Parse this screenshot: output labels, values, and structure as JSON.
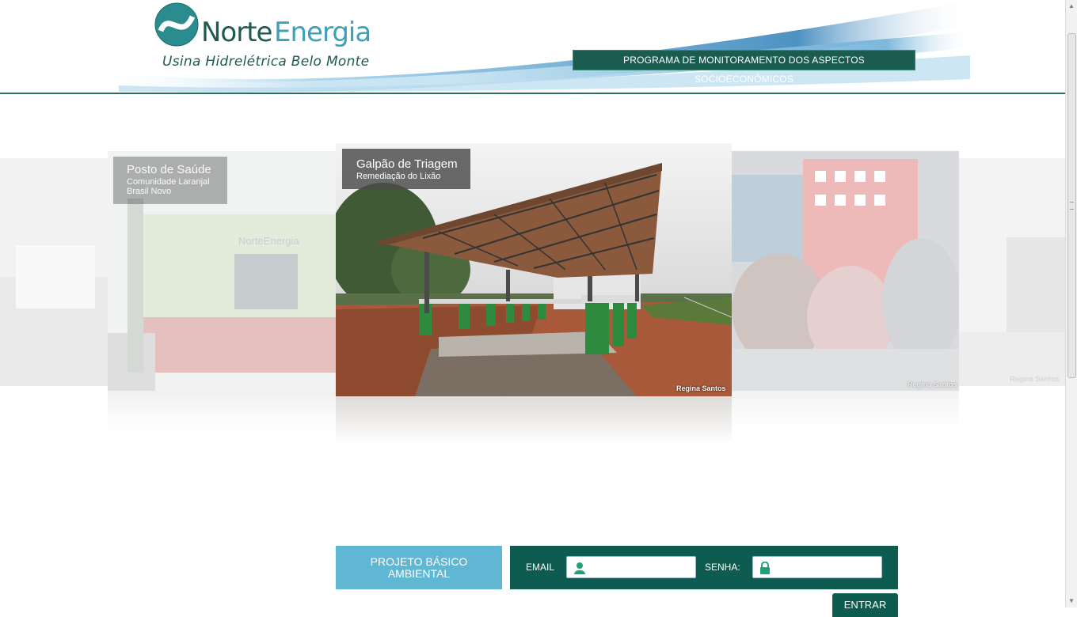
{
  "header": {
    "brand_norte": "Norte",
    "brand_energia": "Energia",
    "tagline": "Usina Hidrelétrica Belo Monte",
    "program_badge": "PROGRAMA DE MONITORAMENTO DOS ASPECTOS SOCIOECONÔMICOS"
  },
  "carousel": {
    "left_slide": {
      "title": "Posto de Saúde",
      "subtitle_line1": "Comunidade Laranjal",
      "subtitle_line2": "Brasil Novo",
      "sign_text": "NorteEnergia"
    },
    "center_slide": {
      "title": "Galpão de Triagem",
      "subtitle": "Remediação do Lixão",
      "credit": "Regina Santos"
    },
    "right_slide": {
      "credit": "Regina Santos"
    },
    "far_right_slide": {
      "credit": "Regina Santos"
    }
  },
  "footer": {
    "pba_button": "PROJETO BÁSICO AMBIENTAL",
    "email_label": "EMAIL",
    "email_value": "",
    "senha_label": "SENHA:",
    "senha_value": "",
    "entrar_button": "ENTRAR"
  },
  "colors": {
    "brand_dark_green": "#0e5c4f",
    "brand_teal": "#3ba0b8",
    "pba_blue": "#5fb7d3"
  },
  "icons": [
    "user-icon",
    "lock-icon",
    "scroll-up-arrow-icon",
    "scroll-down-arrow-icon"
  ]
}
